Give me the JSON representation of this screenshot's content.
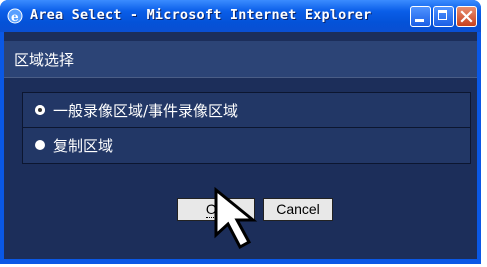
{
  "window": {
    "title": "Area Select - Microsoft Internet Explorer"
  },
  "header": {
    "title": "区域选择"
  },
  "options": [
    {
      "label": "一般录像区域/事件录像区域",
      "checked": true
    },
    {
      "label": "复制区域",
      "checked": false
    }
  ],
  "buttons": {
    "ok": "OK",
    "cancel": "Cancel"
  },
  "colors": {
    "titlebar": "#0a5ee8",
    "client_bg": "#1c2e5a",
    "header_band": "#2c4476"
  },
  "icons": [
    "ie-icon",
    "minimize-icon",
    "maximize-icon",
    "close-icon",
    "radio-checked-icon",
    "radio-icon",
    "pointer-cursor-icon"
  ]
}
